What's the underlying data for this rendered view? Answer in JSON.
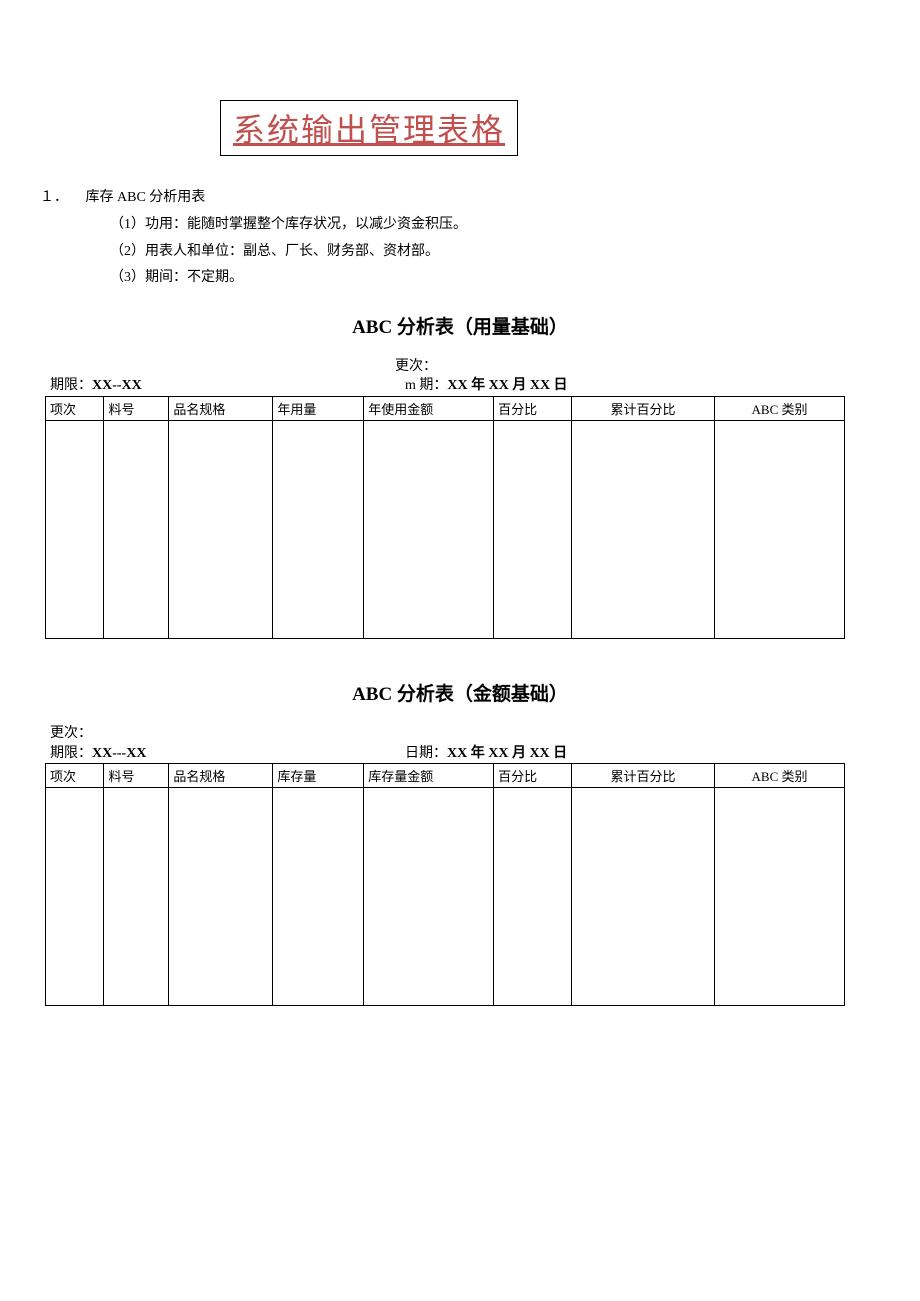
{
  "title": "系统输出管理表格",
  "section_number": "１．",
  "section_label": "库存 ABC 分析用表",
  "bullets": {
    "b1": "（1）功用：能随时掌握整个库存状况，以减少资金积压。",
    "b2": "（2）用表人和单位：副总、厂长、财务部、资材部。",
    "b3": "（3）期间：不定期。"
  },
  "table1": {
    "subtitle": "ABC 分析表（用量基础）",
    "meta_update": "更次：",
    "meta_period_label": "期限：",
    "meta_period_value": "XX--XX",
    "meta_date_label": "m 期：",
    "meta_date_value": "XX 年 XX 月 XX 日",
    "headers": {
      "c1": "项次",
      "c2": "料号",
      "c3": "品名规格",
      "c4": "年用量",
      "c5": "年使用金额",
      "c6": "百分比",
      "c7": "累计百分比",
      "c8": "ABC 类别"
    }
  },
  "table2": {
    "subtitle": "ABC 分析表（金额基础）",
    "meta_update": "更次：",
    "meta_period_label": "期限：",
    "meta_period_value": "XX---XX",
    "meta_date_label": "日期：",
    "meta_date_value": "XX 年 XX 月 XX 日",
    "headers": {
      "c1": "项次",
      "c2": "料号",
      "c3": "品名规格",
      "c4": "库存量",
      "c5": "库存量金额",
      "c6": "百分比",
      "c7": "累计百分比",
      "c8": "ABC 类别"
    }
  }
}
